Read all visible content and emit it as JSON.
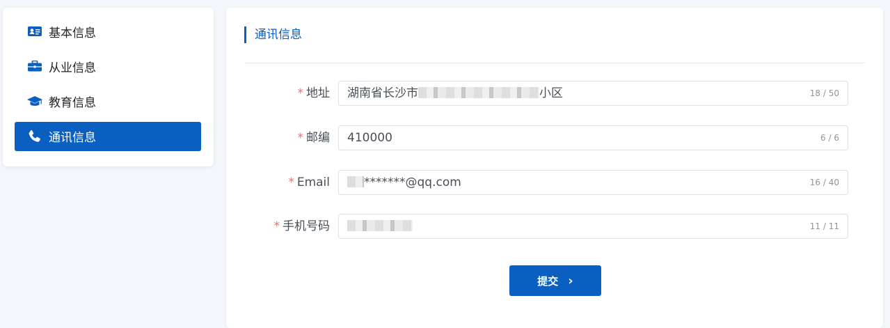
{
  "sidebar": {
    "items": [
      {
        "label": "基本信息",
        "icon": "id-card-icon",
        "active": false
      },
      {
        "label": "从业信息",
        "icon": "briefcase-icon",
        "active": false
      },
      {
        "label": "教育信息",
        "icon": "graduation-cap-icon",
        "active": false
      },
      {
        "label": "通讯信息",
        "icon": "phone-icon",
        "active": true
      }
    ]
  },
  "panel": {
    "title": "通讯信息",
    "fields": [
      {
        "label": "地址",
        "required": "*",
        "value_prefix": "湖南省长沙市",
        "value_suffix": "小区",
        "count": "18 / 50"
      },
      {
        "label": "邮编",
        "required": "*",
        "value": "410000",
        "count": "6 / 6"
      },
      {
        "label": "Email",
        "required": "*",
        "value_suffix": "*******@qq.com",
        "count": "16 / 40"
      },
      {
        "label": "手机号码",
        "required": "*",
        "count": "11 / 11"
      }
    ],
    "submit_label": "提交",
    "submit_icon": "chevron-right-icon"
  },
  "colors": {
    "accent": "#0a5fc0",
    "required": "#f56c6c",
    "background": "#f3f6fb"
  }
}
